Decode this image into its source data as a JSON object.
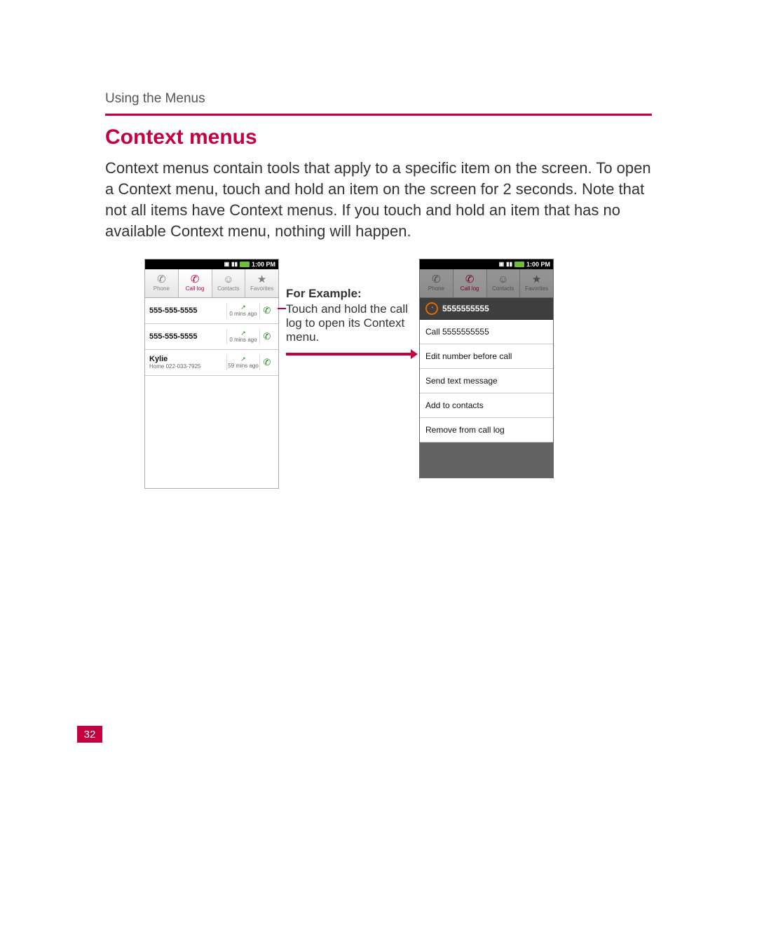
{
  "header": {
    "section": "Using the Menus",
    "title": "Context menus"
  },
  "body": "Context menus contain tools that apply to a specific item on the screen. To open a Context menu, touch and hold an item on the screen for 2 seconds. Note that not all items have Context menus. If you touch and hold an item that has no available Context menu, nothing will happen.",
  "annotation": {
    "label": "For Example:",
    "text": "Touch and hold the call log to open its Context menu."
  },
  "status_time": "1:00 PM",
  "tabs": [
    "Phone",
    "Call log",
    "Contacts",
    "Favorites"
  ],
  "call_log": [
    {
      "name": "555-555-5555",
      "sub": "",
      "time": "0 mins ago",
      "dir": "out"
    },
    {
      "name": "555-555-5555",
      "sub": "",
      "time": "0 mins ago",
      "dir": "out"
    },
    {
      "name": "Kylie",
      "sub": "Home 022-033-7925",
      "time": "59 mins ago",
      "dir": "out"
    }
  ],
  "context_menu": {
    "number": "5555555555",
    "items": [
      "Call 5555555555",
      "Edit number before call",
      "Send text message",
      "Add to contacts",
      "Remove from call log"
    ]
  },
  "page_number": "32"
}
